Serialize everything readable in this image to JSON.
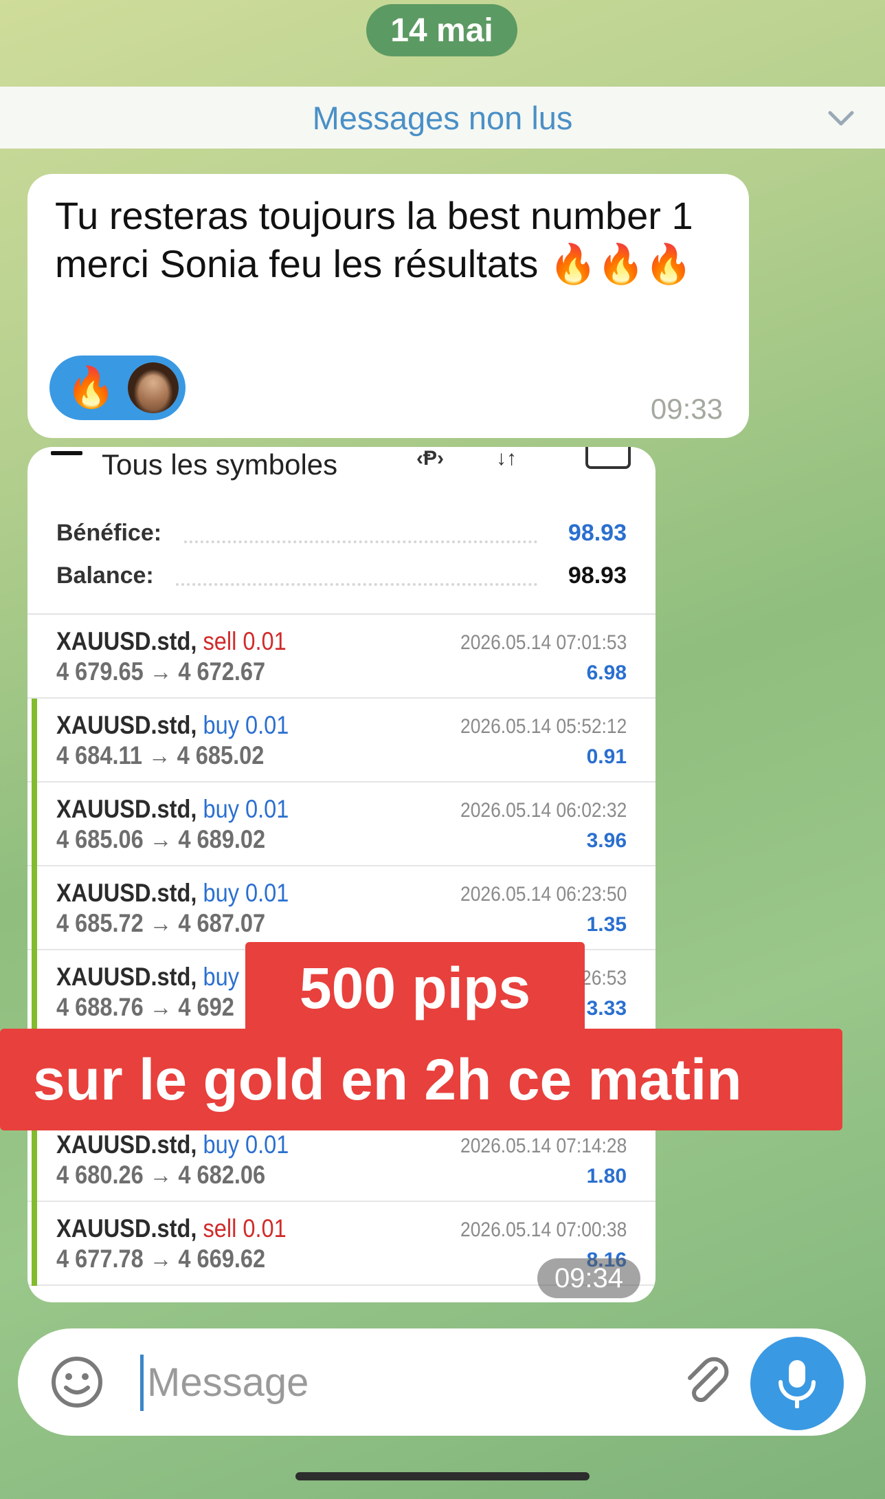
{
  "date_chip": "14 mai",
  "unread_banner": "Messages non lus",
  "message1": {
    "text": "Tu resteras toujours la best number 1 merci Sonia feu les résultats 🔥🔥🔥",
    "reaction_emoji": "🔥",
    "time": "09:33"
  },
  "screenshot": {
    "toolbar_title": "Tous les symboles",
    "toolbar_icons": [
      "menu-icon",
      "sort-icon",
      "filter-icon",
      "keyboard-icon"
    ],
    "profit_label": "Bénéfice:",
    "profit_value": "98.93",
    "balance_label": "Balance:",
    "balance_value": "98.93",
    "trades": [
      {
        "symbol": "XAUUSD.std,",
        "side": "sell 0.01",
        "prices": "4 679.65 → 4 672.67",
        "date": "2026.05.14 07:01:53",
        "profit": "6.98"
      },
      {
        "symbol": "XAUUSD.std,",
        "side": "buy 0.01",
        "prices": "4 684.11 → 4 685.02",
        "date": "2026.05.14 05:52:12",
        "profit": "0.91"
      },
      {
        "symbol": "XAUUSD.std,",
        "side": "buy 0.01",
        "prices": "4 685.06 → 4 689.02",
        "date": "2026.05.14 06:02:32",
        "profit": "3.96"
      },
      {
        "symbol": "XAUUSD.std,",
        "side": "buy 0.01",
        "prices": "4 685.72 → 4 687.07",
        "date": "2026.05.14 06:23:50",
        "profit": "1.35"
      },
      {
        "symbol": "XAUUSD.std,",
        "side": "buy 0.01",
        "prices": "4 688.76 → 4 692",
        "date": "26:53",
        "profit": "3.33"
      },
      {
        "symbol": "",
        "side": "",
        "prices": "",
        "date": "",
        "profit": ""
      },
      {
        "symbol": "XAUUSD.std,",
        "side": "buy 0.01",
        "prices": "4 680.26 → 4 682.06",
        "date": "2026.05.14 07:14:28",
        "profit": "1.80"
      },
      {
        "symbol": "XAUUSD.std,",
        "side": "sell 0.01",
        "prices": "4 677.78 → 4 669.62",
        "date": "2026.05.14 07:00:38",
        "profit": "8.16"
      }
    ],
    "time": "09:34"
  },
  "overlay": {
    "line1": "500 pips",
    "line2": "sur le gold en 2h ce matin"
  },
  "input": {
    "placeholder": "Message"
  },
  "colors": {
    "accent_blue": "#3a99e3",
    "sell_red": "#d12b2b",
    "buy_blue": "#2a6fcf",
    "overlay_red": "#e8403c",
    "date_chip_green": "#5c9a63"
  }
}
